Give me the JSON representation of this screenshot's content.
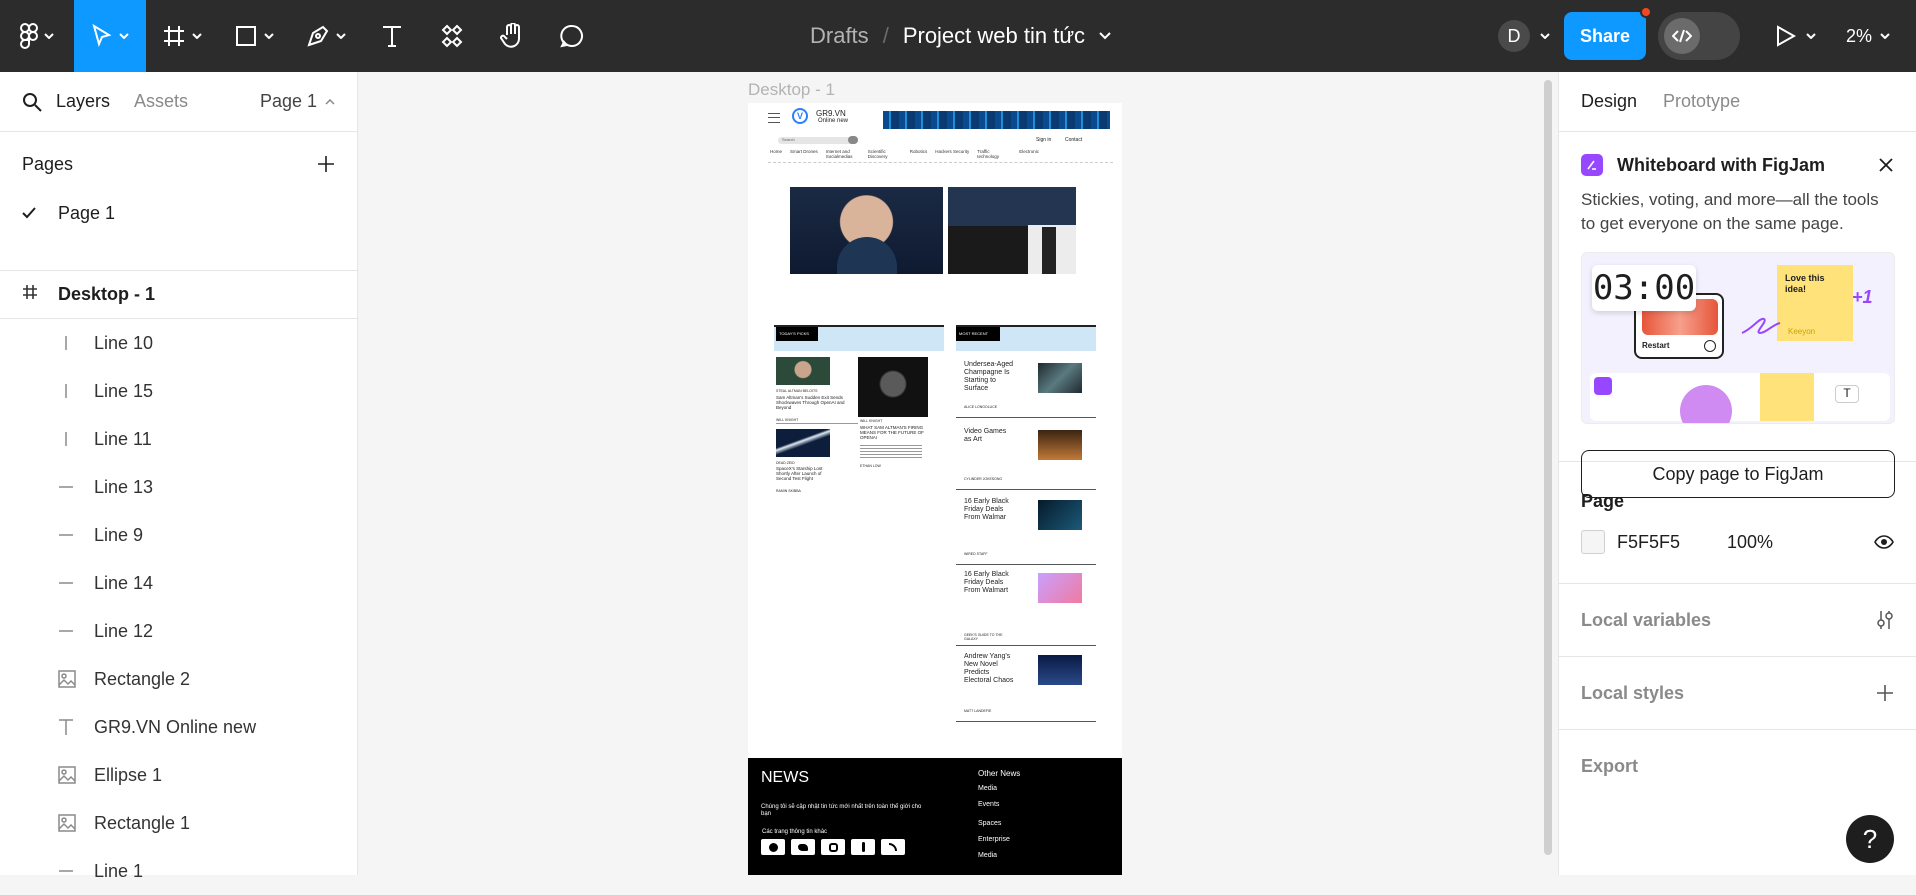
{
  "toolbar": {
    "breadcrumb_drafts": "Drafts",
    "breadcrumb_sep": "/",
    "project_title": "Project web tin tức",
    "avatar_initial": "D",
    "share_label": "Share",
    "zoom": "2%"
  },
  "left_panel": {
    "tab_layers": "Layers",
    "tab_assets": "Assets",
    "page_selector": "Page 1",
    "pages_title": "Pages",
    "pages": [
      {
        "label": "Page 1",
        "selected": true
      }
    ],
    "frame_name": "Desktop - 1",
    "layers": [
      {
        "label": "Line 10",
        "icon": "vertical-line-icon"
      },
      {
        "label": "Line 15",
        "icon": "vertical-line-icon"
      },
      {
        "label": "Line 11",
        "icon": "vertical-line-icon"
      },
      {
        "label": "Line 13",
        "icon": "horizontal-line-icon"
      },
      {
        "label": "Line 9",
        "icon": "horizontal-line-icon"
      },
      {
        "label": "Line 14",
        "icon": "horizontal-line-icon"
      },
      {
        "label": "Line 12",
        "icon": "horizontal-line-icon"
      },
      {
        "label": "Rectangle 2",
        "icon": "image-icon"
      },
      {
        "label": "GR9.VN Online new",
        "icon": "text-icon"
      },
      {
        "label": "Ellipse 1",
        "icon": "image-icon"
      },
      {
        "label": "Rectangle 1",
        "icon": "image-icon"
      },
      {
        "label": "Line 1",
        "icon": "horizontal-line-icon"
      }
    ]
  },
  "canvas": {
    "frame_label": "Desktop - 1",
    "site": {
      "logo": "GR9.VN",
      "logo_sub": "Online new",
      "search_placeholder": "Search",
      "sign_in": "Sign in",
      "contact": "Contact",
      "nav": [
        "Home",
        "Smart Drones",
        "Internet and Socialmedias",
        "Scientific Discovery",
        "Robotics",
        "Hackers Security",
        "Traffic technology",
        "Electronic"
      ],
      "todays_picks": "TODAY'S PICKS",
      "most_recent": "MOST RECENT",
      "picks": [
        {
          "kicker": "STEAL ALTMAN BELOITS",
          "headline": "Sam Altman's Sudden Exit Sends Shockwaves Through OpenAI and Beyond",
          "author": "WILL KNIGHT"
        },
        {
          "kicker": "WILL KNIGHT",
          "headline": "WHAT SAM ALTMAN'S FIRING MEANS FOR THE FUTURE OF OPENAI",
          "author": "ETHAN LOW"
        },
        {
          "kicker": "DEAD ZEID",
          "headline": "SpaceX's Starship Lost Shortly After Launch of Second Test Flight",
          "author": "RAMIN SKIBBA"
        }
      ],
      "recent": [
        {
          "headline": "Undersea-Aged Champagne Is Starting to Surface",
          "author": "ALICE LONGOLUCE"
        },
        {
          "headline": "Video Games as Art",
          "author": "CYLINDER JOKESONG"
        },
        {
          "headline": "16 Early Black Friday Deals From Walmar",
          "author": "WIRED STAFF"
        },
        {
          "headline": "16 Early Black Friday Deals From Walmart",
          "author": "GEEK'S GUIDE TO THE GALAXY"
        },
        {
          "headline": "Andrew Yang's New Novel Predicts Electoral Chaos",
          "author": "MATT LANDEFIE"
        }
      ],
      "footer": {
        "title": "NEWS",
        "desc": "Chúng tôi sẽ cập nhật tin tức mới nhất trên toàn thế giới cho bạn",
        "other_info": "Các trang thông tin khác",
        "links": [
          "Other News",
          "Media",
          "Events",
          "Spaces",
          "Enterprise",
          "Media"
        ]
      }
    }
  },
  "right_panel": {
    "tab_design": "Design",
    "tab_prototype": "Prototype",
    "figjam_title": "Whiteboard with FigJam",
    "figjam_desc": "Stickies, voting, and more—all the tools to get everyone on the same page.",
    "figjam_timer": "03:00",
    "figjam_sticky": "Love this idea!",
    "figjam_restart": "Restart",
    "figjam_cursor_name": "Keeyon",
    "figjam_plus": "+1",
    "copy_button": "Copy page to FigJam",
    "page_section": "Page",
    "page_color": "F5F5F5",
    "page_opacity": "100%",
    "local_variables": "Local variables",
    "local_styles": "Local styles",
    "export": "Export",
    "help": "?"
  },
  "colors": {
    "toolbar_bg": "#2c2c2c",
    "accent": "#0d99ff",
    "figjam_purple": "#9747ff"
  }
}
